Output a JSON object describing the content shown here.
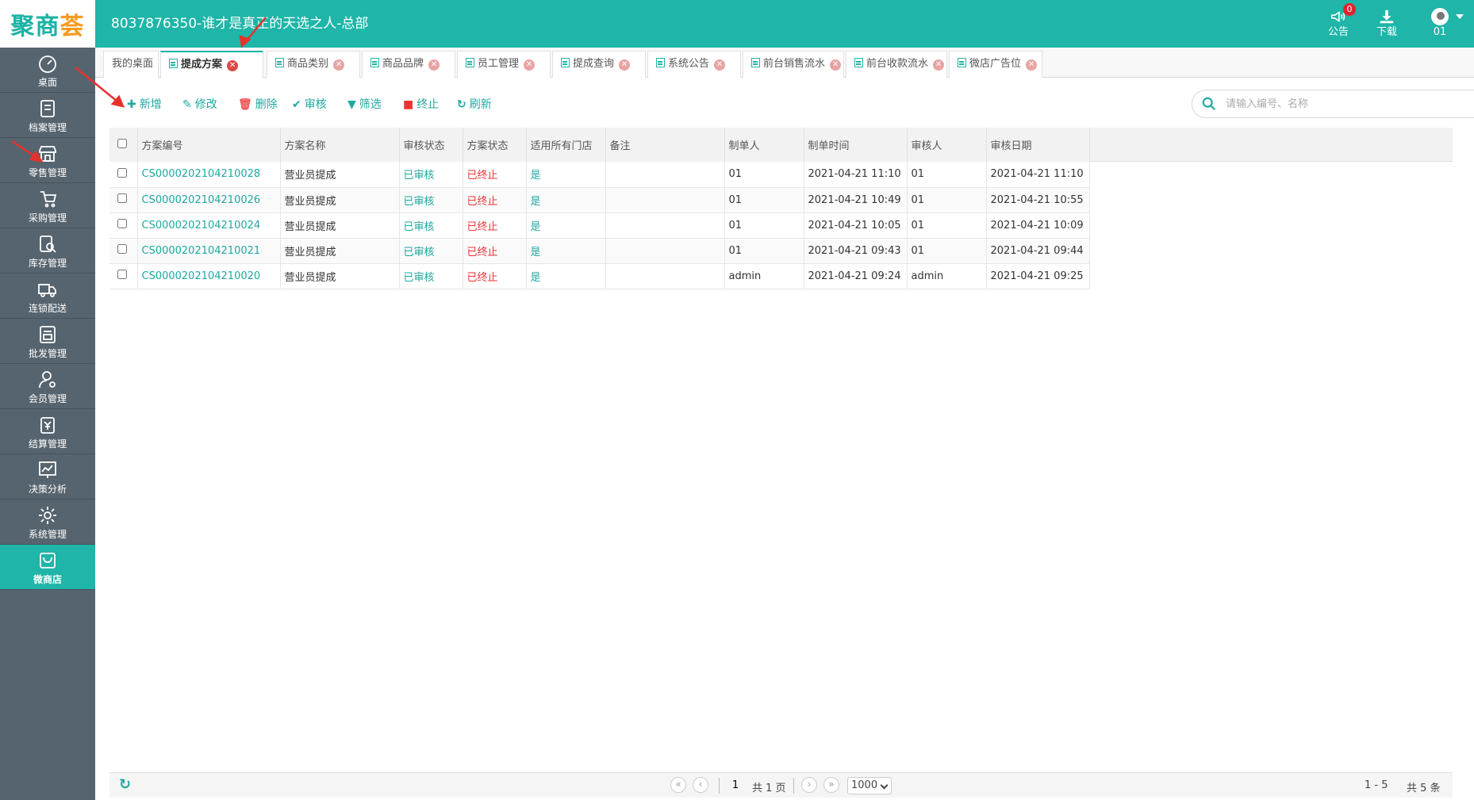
{
  "header": {
    "logo_text": "聚商荟",
    "title": "8037876350-谁才是真正的天选之人-总部",
    "announcement_label": "公告",
    "announcement_badge": "0",
    "download_label": "下载",
    "user_label": "01"
  },
  "sidebar": {
    "items": [
      {
        "label": "桌面",
        "icon": "dashboard-icon"
      },
      {
        "label": "档案管理",
        "icon": "archive-icon"
      },
      {
        "label": "零售管理",
        "icon": "store-icon"
      },
      {
        "label": "采购管理",
        "icon": "purchase-icon"
      },
      {
        "label": "库存管理",
        "icon": "inventory-icon"
      },
      {
        "label": "连锁配送",
        "icon": "truck-icon"
      },
      {
        "label": "批发管理",
        "icon": "wholesale-icon"
      },
      {
        "label": "会员管理",
        "icon": "member-icon"
      },
      {
        "label": "结算管理",
        "icon": "settlement-icon"
      },
      {
        "label": "决策分析",
        "icon": "chart-icon"
      },
      {
        "label": "系统管理",
        "icon": "gear-icon"
      },
      {
        "label": "微商店",
        "icon": "shop-bag-icon",
        "active": true
      }
    ]
  },
  "tabs": [
    {
      "label": "我的桌面"
    },
    {
      "label": "提成方案",
      "active": true
    },
    {
      "label": "商品类别"
    },
    {
      "label": "商品品牌"
    },
    {
      "label": "员工管理"
    },
    {
      "label": "提成查询"
    },
    {
      "label": "系统公告"
    },
    {
      "label": "前台销售流水"
    },
    {
      "label": "前台收款流水"
    },
    {
      "label": "微店广告位"
    }
  ],
  "toolbar": {
    "add": "新增",
    "edit": "修改",
    "delete": "删除",
    "audit": "审核",
    "filter": "筛选",
    "terminate": "终止",
    "refresh": "刷新"
  },
  "search": {
    "placeholder": "请输入编号、名称",
    "button": "搜索"
  },
  "table": {
    "columns": [
      "方案编号",
      "方案名称",
      "审核状态",
      "方案状态",
      "适用所有门店",
      "备注",
      "制单人",
      "制单时间",
      "审核人",
      "审核日期"
    ],
    "rows": [
      [
        "CS0000202104210028",
        "营业员提成",
        "已审核",
        "已终止",
        "是",
        "",
        "01",
        "2021-04-21 11:10",
        "01",
        "2021-04-21 11:10"
      ],
      [
        "CS0000202104210026",
        "营业员提成",
        "已审核",
        "已终止",
        "是",
        "",
        "01",
        "2021-04-21 10:49",
        "01",
        "2021-04-21 10:55"
      ],
      [
        "CS0000202104210024",
        "营业员提成",
        "已审核",
        "已终止",
        "是",
        "",
        "01",
        "2021-04-21 10:05",
        "01",
        "2021-04-21 10:09"
      ],
      [
        "CS0000202104210021",
        "营业员提成",
        "已审核",
        "已终止",
        "是",
        "",
        "01",
        "2021-04-21 09:43",
        "01",
        "2021-04-21 09:44"
      ],
      [
        "CS0000202104210020",
        "营业员提成",
        "已审核",
        "已终止",
        "是",
        "",
        "admin",
        "2021-04-21 09:24",
        "admin",
        "2021-04-21 09:25"
      ]
    ]
  },
  "pager": {
    "current_page": "1",
    "total_pages_text": "共 1 页",
    "page_size": "1000",
    "range_text": "1 - 5",
    "total_text": "共 5 条"
  },
  "colors": {
    "brand": "#1fb5a8",
    "sidebar": "#56646f",
    "danger": "#e33333"
  }
}
